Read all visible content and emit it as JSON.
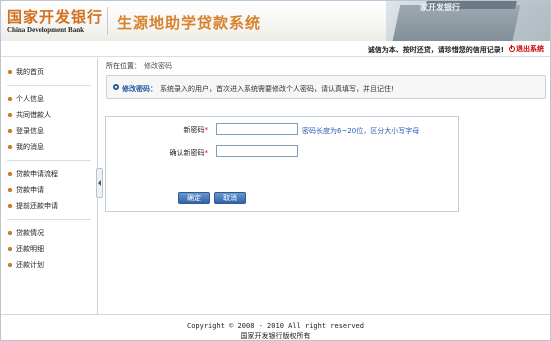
{
  "header": {
    "logo_cn": "国家开发银行",
    "logo_en": "China Development Bank",
    "system_title": "生源地助学贷款系统",
    "building_sign": "家开发银行"
  },
  "slogan_bar": {
    "slogan": "诚信为本、按时还贷，请珍惜您的信用记录!",
    "logout_label": "退出系统"
  },
  "sidebar": {
    "groups": [
      {
        "items": [
          {
            "label": "我的首页"
          }
        ]
      },
      {
        "items": [
          {
            "label": "个人信息"
          },
          {
            "label": "共同借款人"
          },
          {
            "label": "登录信息"
          },
          {
            "label": "我的消息"
          }
        ]
      },
      {
        "items": [
          {
            "label": "贷款申请流程"
          },
          {
            "label": "贷款申请"
          },
          {
            "label": "提前还款申请"
          }
        ]
      },
      {
        "items": [
          {
            "label": "贷款情况"
          },
          {
            "label": "还款明细"
          },
          {
            "label": "还款计划"
          }
        ]
      }
    ]
  },
  "main": {
    "breadcrumb_prefix": "所在位置：",
    "breadcrumb_current": "修改密码",
    "notice_label": "修改密码：",
    "notice_text": "系统录入的用户，首次进入系统需要修改个人密码，请认真填写，并且记住!",
    "form": {
      "new_password_label": "新密码",
      "new_password_value": "",
      "hint": "密码长度为6~20位，区分大小写字母",
      "confirm_password_label": "确认新密码",
      "confirm_password_value": "",
      "confirm_button": "确定",
      "cancel_button": "取消"
    }
  },
  "footer": {
    "copyright": "Copyright © 2008 - 2010 All right reserved",
    "owner": "国家开发银行版权所有"
  },
  "colors": {
    "accent_orange": "#d9822b",
    "link_blue": "#2a5eb8",
    "logout_red": "#cc0000",
    "button_blue": "#2f65a8"
  }
}
